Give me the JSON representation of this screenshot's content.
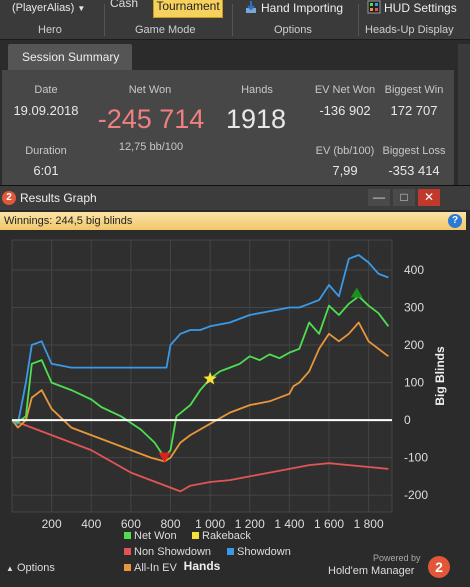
{
  "toolbar": {
    "hero_value": "(PlayerAlias)",
    "hero_label": "Hero",
    "cash_label": "Cash",
    "tournament_label": "Tournament",
    "game_mode_label": "Game Mode",
    "hand_importing_label": "Hand Importing",
    "options_label": "Options",
    "hud_settings_label": "HUD Settings",
    "headsup_label": "Heads-Up Display"
  },
  "session": {
    "tab_label": "Session Summary",
    "date_label": "Date",
    "date_value": "19.09.2018",
    "duration_label": "Duration",
    "duration_value": "6:01",
    "netwon_label": "Net Won",
    "netwon_value": "-245 714",
    "bb_rate": "12,75 bb/100",
    "hands_label": "Hands",
    "hands_value": "1918",
    "ev_netwon_label": "EV Net Won",
    "ev_netwon_value": "-136 902",
    "biggest_win_label": "Biggest Win",
    "biggest_win_value": "172 707",
    "ev_bb_label": "EV (bb/100)",
    "ev_bb_value": "7,99",
    "biggest_loss_label": "Biggest Loss",
    "biggest_loss_value": "-353 414"
  },
  "graph_window": {
    "badge": "2",
    "title": "Results Graph",
    "minimize": "—",
    "maximize": "□",
    "close": "✕",
    "winnings_text": "Winnings: 244,5 big blinds",
    "help": "?"
  },
  "chart_data": {
    "type": "line",
    "xlabel": "Hands",
    "ylabel": "Big Blinds",
    "xlim": [
      0,
      1918
    ],
    "ylim": [
      -245,
      480
    ],
    "x_ticks": [
      "200",
      "400",
      "600",
      "800",
      "1 000",
      "1 200",
      "1 400",
      "1 600",
      "1 800"
    ],
    "x_tick_values": [
      200,
      400,
      600,
      800,
      1000,
      1200,
      1400,
      1600,
      1800
    ],
    "y_ticks": [
      "400",
      "300",
      "200",
      "100",
      "0",
      "-100",
      "-200"
    ],
    "y_tick_values": [
      400,
      300,
      200,
      100,
      0,
      -100,
      -200
    ],
    "grid": true,
    "series": [
      {
        "name": "Net Won",
        "color": "#4fde4f",
        "points": [
          [
            0,
            0
          ],
          [
            30,
            -5
          ],
          [
            70,
            10
          ],
          [
            100,
            150
          ],
          [
            150,
            160
          ],
          [
            200,
            100
          ],
          [
            300,
            80
          ],
          [
            400,
            55
          ],
          [
            450,
            35
          ],
          [
            550,
            10
          ],
          [
            650,
            -25
          ],
          [
            720,
            -60
          ],
          [
            770,
            -100
          ],
          [
            800,
            -80
          ],
          [
            830,
            10
          ],
          [
            900,
            40
          ],
          [
            950,
            80
          ],
          [
            1000,
            110
          ],
          [
            1050,
            130
          ],
          [
            1100,
            140
          ],
          [
            1150,
            150
          ],
          [
            1200,
            170
          ],
          [
            1250,
            160
          ],
          [
            1300,
            175
          ],
          [
            1350,
            165
          ],
          [
            1400,
            180
          ],
          [
            1450,
            190
          ],
          [
            1500,
            260
          ],
          [
            1550,
            230
          ],
          [
            1600,
            305
          ],
          [
            1650,
            280
          ],
          [
            1700,
            310
          ],
          [
            1750,
            330
          ],
          [
            1800,
            305
          ],
          [
            1850,
            285
          ],
          [
            1900,
            250
          ]
        ]
      },
      {
        "name": "Showdown",
        "color": "#3a9ae8",
        "points": [
          [
            0,
            0
          ],
          [
            30,
            -10
          ],
          [
            70,
            100
          ],
          [
            100,
            200
          ],
          [
            150,
            210
          ],
          [
            200,
            150
          ],
          [
            300,
            140
          ],
          [
            400,
            140
          ],
          [
            500,
            140
          ],
          [
            600,
            140
          ],
          [
            700,
            140
          ],
          [
            780,
            140
          ],
          [
            800,
            200
          ],
          [
            850,
            230
          ],
          [
            900,
            240
          ],
          [
            950,
            240
          ],
          [
            1000,
            250
          ],
          [
            1100,
            260
          ],
          [
            1200,
            280
          ],
          [
            1300,
            290
          ],
          [
            1400,
            300
          ],
          [
            1450,
            300
          ],
          [
            1500,
            310
          ],
          [
            1550,
            320
          ],
          [
            1600,
            360
          ],
          [
            1650,
            330
          ],
          [
            1700,
            430
          ],
          [
            1750,
            440
          ],
          [
            1800,
            420
          ],
          [
            1850,
            390
          ],
          [
            1900,
            380
          ]
        ]
      },
      {
        "name": "All-In EV",
        "color": "#e8973a",
        "points": [
          [
            0,
            0
          ],
          [
            30,
            -20
          ],
          [
            70,
            0
          ],
          [
            100,
            60
          ],
          [
            150,
            80
          ],
          [
            200,
            30
          ],
          [
            300,
            -20
          ],
          [
            400,
            -40
          ],
          [
            500,
            -60
          ],
          [
            600,
            -80
          ],
          [
            700,
            -100
          ],
          [
            770,
            -110
          ],
          [
            800,
            -100
          ],
          [
            850,
            -60
          ],
          [
            900,
            -40
          ],
          [
            1000,
            -10
          ],
          [
            1100,
            20
          ],
          [
            1200,
            40
          ],
          [
            1300,
            50
          ],
          [
            1400,
            70
          ],
          [
            1420,
            90
          ],
          [
            1450,
            100
          ],
          [
            1500,
            130
          ],
          [
            1550,
            190
          ],
          [
            1600,
            230
          ],
          [
            1650,
            210
          ],
          [
            1700,
            230
          ],
          [
            1750,
            260
          ],
          [
            1800,
            210
          ],
          [
            1850,
            190
          ],
          [
            1900,
            170
          ]
        ]
      },
      {
        "name": "Non Showdown",
        "color": "#e05555",
        "points": [
          [
            0,
            0
          ],
          [
            100,
            -20
          ],
          [
            200,
            -40
          ],
          [
            300,
            -60
          ],
          [
            400,
            -80
          ],
          [
            500,
            -110
          ],
          [
            600,
            -140
          ],
          [
            700,
            -160
          ],
          [
            800,
            -180
          ],
          [
            850,
            -190
          ],
          [
            900,
            -175
          ],
          [
            1000,
            -165
          ],
          [
            1100,
            -160
          ],
          [
            1200,
            -150
          ],
          [
            1300,
            -140
          ],
          [
            1400,
            -130
          ],
          [
            1500,
            -120
          ],
          [
            1600,
            -115
          ],
          [
            1700,
            -120
          ],
          [
            1800,
            -125
          ],
          [
            1900,
            -130
          ]
        ]
      },
      {
        "name": "Rakeback",
        "color": "#ffffff",
        "points": [
          [
            0,
            0
          ],
          [
            1918,
            0
          ]
        ]
      }
    ],
    "markers": [
      {
        "type": "star",
        "x": 1000,
        "y": 110,
        "color": "#f7e03a"
      },
      {
        "type": "triangle-down",
        "x": 770,
        "y": -100,
        "color": "#e02020"
      },
      {
        "type": "triangle-up",
        "x": 1740,
        "y": 340,
        "color": "#1e8f1e"
      }
    ],
    "legend_position": "bottom",
    "legend": [
      {
        "name": "Net Won",
        "color": "#4fde4f"
      },
      {
        "name": "Rakeback",
        "color": "#f7e03a"
      },
      {
        "name": "Non Showdown",
        "color": "#e05555"
      },
      {
        "name": "Showdown",
        "color": "#3a9ae8"
      },
      {
        "name": "All-In EV",
        "color": "#e8973a"
      }
    ]
  },
  "footer": {
    "options_label": "Options",
    "powered_by": "Powered by",
    "brand": "Hold'em Manager",
    "brand_badge": "2"
  }
}
